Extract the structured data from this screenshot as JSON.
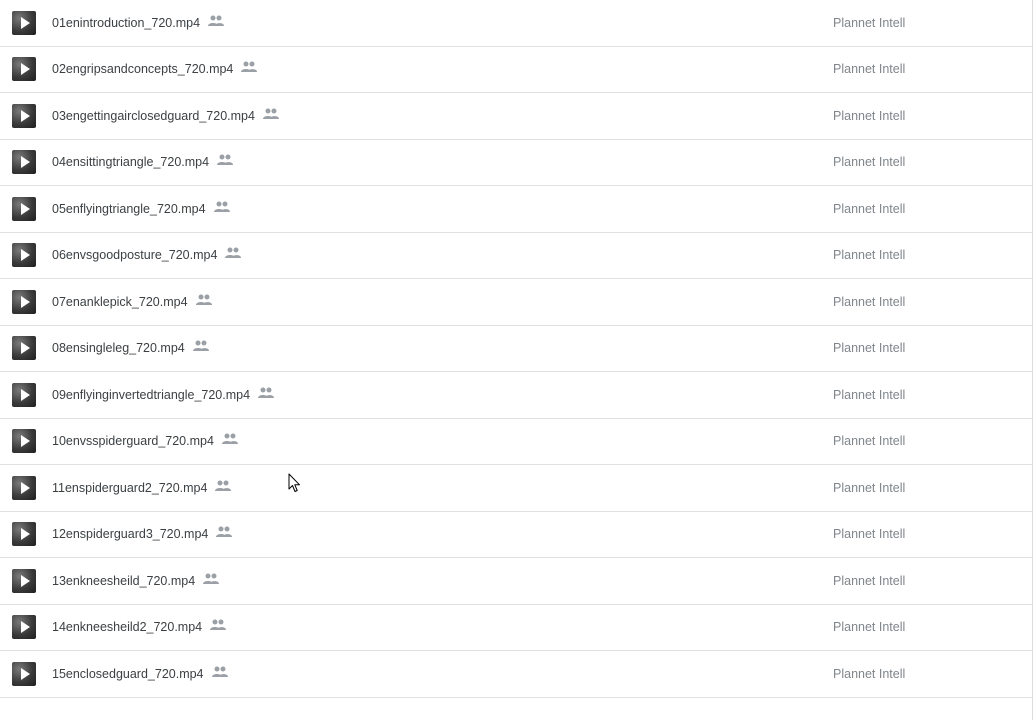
{
  "files": [
    {
      "name": "01enintroduction_720.mp4",
      "owner": "Plannet Intell"
    },
    {
      "name": "02engripsandconcepts_720.mp4",
      "owner": "Plannet Intell"
    },
    {
      "name": "03engettingairclosedguard_720.mp4",
      "owner": "Plannet Intell"
    },
    {
      "name": "04ensittingtriangle_720.mp4",
      "owner": "Plannet Intell"
    },
    {
      "name": "05enflyingtriangle_720.mp4",
      "owner": "Plannet Intell"
    },
    {
      "name": "06envsgoodposture_720.mp4",
      "owner": "Plannet Intell"
    },
    {
      "name": "07enanklepick_720.mp4",
      "owner": "Plannet Intell"
    },
    {
      "name": "08ensingleleg_720.mp4",
      "owner": "Plannet Intell"
    },
    {
      "name": "09enflyinginvertedtriangle_720.mp4",
      "owner": "Plannet Intell"
    },
    {
      "name": "10envsspiderguard_720.mp4",
      "owner": "Plannet Intell"
    },
    {
      "name": "11enspiderguard2_720.mp4",
      "owner": "Plannet Intell"
    },
    {
      "name": "12enspiderguard3_720.mp4",
      "owner": "Plannet Intell"
    },
    {
      "name": "13enkneesheild_720.mp4",
      "owner": "Plannet Intell"
    },
    {
      "name": "14enkneesheild2_720.mp4",
      "owner": "Plannet Intell"
    },
    {
      "name": "15enclosedguard_720.mp4",
      "owner": "Plannet Intell"
    }
  ],
  "icons": {
    "thumbnail": "video-play-icon",
    "shared": "shared-people-icon"
  },
  "colors": {
    "file_name": "#3c4043",
    "owner": "#80868b",
    "divider": "#e0e0e0",
    "shared_icon": "#9aa0a6"
  }
}
